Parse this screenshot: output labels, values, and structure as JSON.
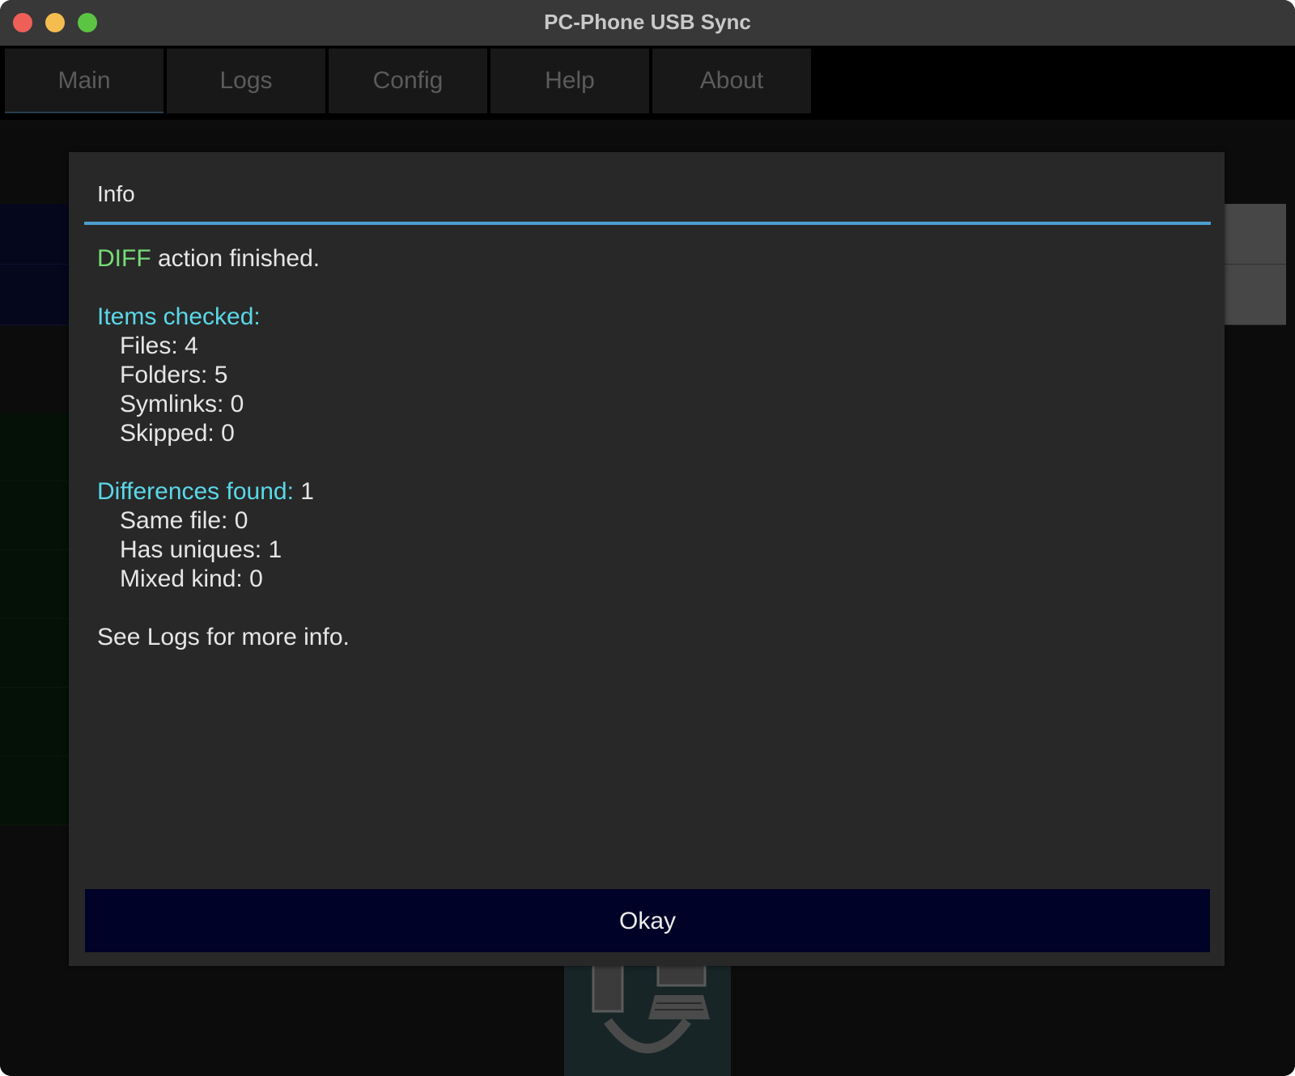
{
  "window": {
    "title": "PC-Phone USB Sync"
  },
  "tabs": [
    {
      "label": "Main",
      "active": true
    },
    {
      "label": "Logs",
      "active": false
    },
    {
      "label": "Config",
      "active": false
    },
    {
      "label": "Help",
      "active": false
    },
    {
      "label": "About",
      "active": false
    }
  ],
  "dialog": {
    "title": "Info",
    "action_name": "DIFF",
    "action_suffix": " action finished.",
    "items_checked_heading": "Items checked:",
    "items_checked": [
      "Files: 4",
      "Folders: 5",
      "Symlinks: 0",
      "Skipped: 0"
    ],
    "differences_heading": "Differences found:",
    "differences_count": " 1",
    "differences": [
      "Same file: 0",
      "Has uniques: 1",
      "Mixed kind: 0"
    ],
    "footer_note": "See Logs for more info.",
    "okay_label": "Okay"
  },
  "colors": {
    "accent_separator": "#4a9fcf",
    "action_green": "#77dd77",
    "heading_cyan": "#5ad8e8",
    "button_bg": "#010227"
  },
  "icons": {
    "device_icon": "pc-phone-usb-icon"
  }
}
